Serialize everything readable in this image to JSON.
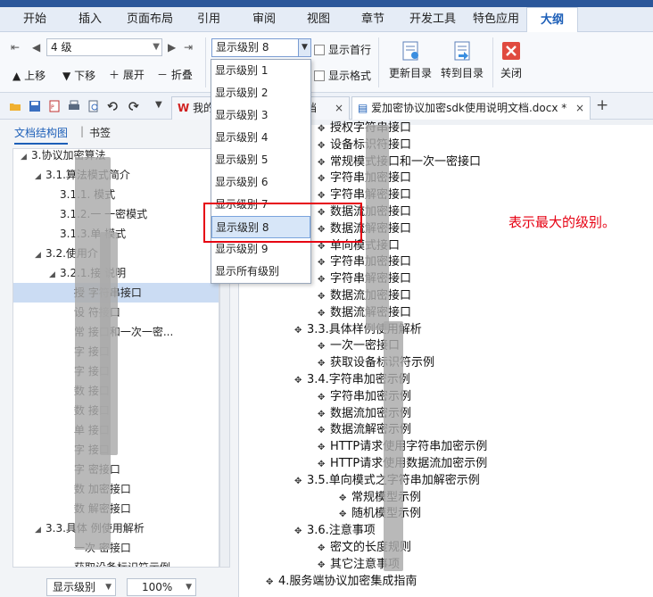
{
  "menu": {
    "tabs": [
      "开始",
      "插入",
      "页面布局",
      "引用",
      "审阅",
      "视图",
      "章节",
      "开发工具",
      "特色应用",
      "大纲"
    ],
    "active": "大纲"
  },
  "ribbon": {
    "level_value": "4 级",
    "move_up": "上移",
    "move_down": "下移",
    "expand": "展开",
    "collapse": "折叠",
    "show_level_value": "显示级别 8",
    "show_first_line": "显示首行",
    "show_format": "显示格式",
    "update_toc": "更新目录",
    "goto_toc": "转到目录",
    "close": "关闭"
  },
  "doc_tabs": {
    "my_label": "我的",
    "partial_tab": "档",
    "active_tab": "爱加密协议加密sdk使用说明文档.docx *",
    "close": "×",
    "add": "+"
  },
  "left_pane": {
    "tabs": [
      "文档结构图",
      "书签"
    ],
    "tree": [
      {
        "text": "3.协议加密算法",
        "depth": 0,
        "tri": "◢"
      },
      {
        "text": "3.1.算法模式简介",
        "depth": 1,
        "tri": "◢"
      },
      {
        "text": "3.1.1.    模式",
        "depth": 2,
        "tri": ""
      },
      {
        "text": "3.1.2.一   一密模式",
        "depth": 2,
        "tri": ""
      },
      {
        "text": "3.1.3.单    模式",
        "depth": 2,
        "tri": ""
      },
      {
        "text": "3.2.使用介",
        "depth": 1,
        "tri": "◢"
      },
      {
        "text": "3.2.1.接    说明",
        "depth": 2,
        "tri": "◢"
      },
      {
        "text": "授    字符串接口",
        "depth": 3,
        "tri": ""
      },
      {
        "text": "设    符接口",
        "depth": 3,
        "tri": ""
      },
      {
        "text": "常    接口和一次一密...",
        "depth": 3,
        "tri": ""
      },
      {
        "text": "字    接口",
        "depth": 3,
        "tri": ""
      },
      {
        "text": "字    接口",
        "depth": 3,
        "tri": ""
      },
      {
        "text": "数    接口",
        "depth": 3,
        "tri": ""
      },
      {
        "text": "数    接口",
        "depth": 3,
        "tri": ""
      },
      {
        "text": "单    接口",
        "depth": 3,
        "tri": ""
      },
      {
        "text": "字    接口",
        "depth": 3,
        "tri": ""
      },
      {
        "text": "字    密接口",
        "depth": 3,
        "tri": ""
      },
      {
        "text": "数    加密接口",
        "depth": 3,
        "tri": ""
      },
      {
        "text": "数    解密接口",
        "depth": 3,
        "tri": ""
      },
      {
        "text": "3.3.具体    例使用解析",
        "depth": 1,
        "tri": "◢"
      },
      {
        "text": "一次    密接口",
        "depth": 3,
        "tri": ""
      },
      {
        "text": "获取设备标识符示例",
        "depth": 3,
        "tri": ""
      }
    ],
    "selected_index": 7,
    "show_level_button": "显示级别",
    "zoom": "100%"
  },
  "dropdown": {
    "options": [
      "显示级别 1",
      "显示级别 2",
      "显示级别 3",
      "显示级别 4",
      "显示级别 5",
      "显示级别 6",
      "显示级别 7",
      "显示级别 8",
      "显示级别 9",
      "显示所有级别"
    ],
    "selected_index": 7
  },
  "annotation": "表示最大的级别。",
  "document": {
    "lines": [
      {
        "text": "授权字符串接口",
        "indent": 2
      },
      {
        "text": "设备标识符接口",
        "indent": 2
      },
      {
        "text": "常规模式接口和一次一密接口",
        "indent": 2
      },
      {
        "text": "字符串加密接口",
        "indent": 2
      },
      {
        "text": "字符串解密接口",
        "indent": 2
      },
      {
        "text": "数据流加密接口",
        "indent": 2
      },
      {
        "text": "数据流解密接口",
        "indent": 2
      },
      {
        "text": "单向模式接口",
        "indent": 2
      },
      {
        "text": "字符串加密接口",
        "indent": 2
      },
      {
        "text": "字符串解密接口",
        "indent": 2
      },
      {
        "text": "数据流加密接口",
        "indent": 2
      },
      {
        "text": "数据流解密接口",
        "indent": 2
      },
      {
        "text": "3.3.具体样例使用解析",
        "indent": 1
      },
      {
        "text": "一次一密接口",
        "indent": 2
      },
      {
        "text": "获取设备标识符示例",
        "indent": 2
      },
      {
        "text": "3.4.字符串加密示例",
        "indent": 1
      },
      {
        "text": "字符串加密示例",
        "indent": 2
      },
      {
        "text": "数据流加密示例",
        "indent": 2
      },
      {
        "text": "数据流解密示例",
        "indent": 2
      },
      {
        "text": "HTTP请求使用字符串加密示例",
        "indent": 2
      },
      {
        "text": "HTTP请求使用数据流加密示例",
        "indent": 2
      },
      {
        "text": "3.5.单向模式之字符串加解密示例",
        "indent": 1
      },
      {
        "text": "常规模型示例",
        "indent": 3
      },
      {
        "text": "随机模型示例",
        "indent": 3
      },
      {
        "text": "3.6.注意事项",
        "indent": 1
      },
      {
        "text": "密文的长度规则",
        "indent": 2
      },
      {
        "text": "其它注意事项",
        "indent": 2
      },
      {
        "text": "4.服务端协议加密集成指南",
        "indent": 0
      }
    ]
  }
}
